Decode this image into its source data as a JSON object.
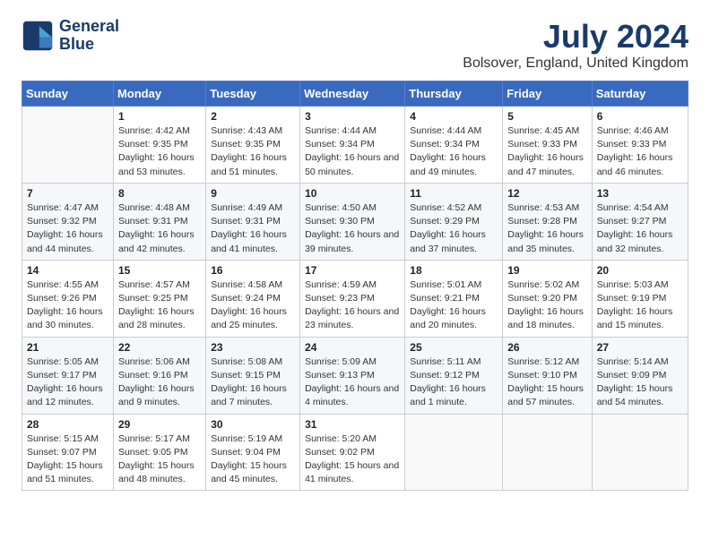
{
  "header": {
    "logo_line1": "General",
    "logo_line2": "Blue",
    "main_title": "July 2024",
    "subtitle": "Bolsover, England, United Kingdom"
  },
  "calendar": {
    "days_of_week": [
      "Sunday",
      "Monday",
      "Tuesday",
      "Wednesday",
      "Thursday",
      "Friday",
      "Saturday"
    ],
    "weeks": [
      [
        {
          "day": "",
          "empty": true
        },
        {
          "day": "1",
          "rise": "Sunrise: 4:42 AM",
          "set": "Sunset: 9:35 PM",
          "daylight": "Daylight: 16 hours and 53 minutes."
        },
        {
          "day": "2",
          "rise": "Sunrise: 4:43 AM",
          "set": "Sunset: 9:35 PM",
          "daylight": "Daylight: 16 hours and 51 minutes."
        },
        {
          "day": "3",
          "rise": "Sunrise: 4:44 AM",
          "set": "Sunset: 9:34 PM",
          "daylight": "Daylight: 16 hours and 50 minutes."
        },
        {
          "day": "4",
          "rise": "Sunrise: 4:44 AM",
          "set": "Sunset: 9:34 PM",
          "daylight": "Daylight: 16 hours and 49 minutes."
        },
        {
          "day": "5",
          "rise": "Sunrise: 4:45 AM",
          "set": "Sunset: 9:33 PM",
          "daylight": "Daylight: 16 hours and 47 minutes."
        },
        {
          "day": "6",
          "rise": "Sunrise: 4:46 AM",
          "set": "Sunset: 9:33 PM",
          "daylight": "Daylight: 16 hours and 46 minutes."
        }
      ],
      [
        {
          "day": "7",
          "rise": "Sunrise: 4:47 AM",
          "set": "Sunset: 9:32 PM",
          "daylight": "Daylight: 16 hours and 44 minutes."
        },
        {
          "day": "8",
          "rise": "Sunrise: 4:48 AM",
          "set": "Sunset: 9:31 PM",
          "daylight": "Daylight: 16 hours and 42 minutes."
        },
        {
          "day": "9",
          "rise": "Sunrise: 4:49 AM",
          "set": "Sunset: 9:31 PM",
          "daylight": "Daylight: 16 hours and 41 minutes."
        },
        {
          "day": "10",
          "rise": "Sunrise: 4:50 AM",
          "set": "Sunset: 9:30 PM",
          "daylight": "Daylight: 16 hours and 39 minutes."
        },
        {
          "day": "11",
          "rise": "Sunrise: 4:52 AM",
          "set": "Sunset: 9:29 PM",
          "daylight": "Daylight: 16 hours and 37 minutes."
        },
        {
          "day": "12",
          "rise": "Sunrise: 4:53 AM",
          "set": "Sunset: 9:28 PM",
          "daylight": "Daylight: 16 hours and 35 minutes."
        },
        {
          "day": "13",
          "rise": "Sunrise: 4:54 AM",
          "set": "Sunset: 9:27 PM",
          "daylight": "Daylight: 16 hours and 32 minutes."
        }
      ],
      [
        {
          "day": "14",
          "rise": "Sunrise: 4:55 AM",
          "set": "Sunset: 9:26 PM",
          "daylight": "Daylight: 16 hours and 30 minutes."
        },
        {
          "day": "15",
          "rise": "Sunrise: 4:57 AM",
          "set": "Sunset: 9:25 PM",
          "daylight": "Daylight: 16 hours and 28 minutes."
        },
        {
          "day": "16",
          "rise": "Sunrise: 4:58 AM",
          "set": "Sunset: 9:24 PM",
          "daylight": "Daylight: 16 hours and 25 minutes."
        },
        {
          "day": "17",
          "rise": "Sunrise: 4:59 AM",
          "set": "Sunset: 9:23 PM",
          "daylight": "Daylight: 16 hours and 23 minutes."
        },
        {
          "day": "18",
          "rise": "Sunrise: 5:01 AM",
          "set": "Sunset: 9:21 PM",
          "daylight": "Daylight: 16 hours and 20 minutes."
        },
        {
          "day": "19",
          "rise": "Sunrise: 5:02 AM",
          "set": "Sunset: 9:20 PM",
          "daylight": "Daylight: 16 hours and 18 minutes."
        },
        {
          "day": "20",
          "rise": "Sunrise: 5:03 AM",
          "set": "Sunset: 9:19 PM",
          "daylight": "Daylight: 16 hours and 15 minutes."
        }
      ],
      [
        {
          "day": "21",
          "rise": "Sunrise: 5:05 AM",
          "set": "Sunset: 9:17 PM",
          "daylight": "Daylight: 16 hours and 12 minutes."
        },
        {
          "day": "22",
          "rise": "Sunrise: 5:06 AM",
          "set": "Sunset: 9:16 PM",
          "daylight": "Daylight: 16 hours and 9 minutes."
        },
        {
          "day": "23",
          "rise": "Sunrise: 5:08 AM",
          "set": "Sunset: 9:15 PM",
          "daylight": "Daylight: 16 hours and 7 minutes."
        },
        {
          "day": "24",
          "rise": "Sunrise: 5:09 AM",
          "set": "Sunset: 9:13 PM",
          "daylight": "Daylight: 16 hours and 4 minutes."
        },
        {
          "day": "25",
          "rise": "Sunrise: 5:11 AM",
          "set": "Sunset: 9:12 PM",
          "daylight": "Daylight: 16 hours and 1 minute."
        },
        {
          "day": "26",
          "rise": "Sunrise: 5:12 AM",
          "set": "Sunset: 9:10 PM",
          "daylight": "Daylight: 15 hours and 57 minutes."
        },
        {
          "day": "27",
          "rise": "Sunrise: 5:14 AM",
          "set": "Sunset: 9:09 PM",
          "daylight": "Daylight: 15 hours and 54 minutes."
        }
      ],
      [
        {
          "day": "28",
          "rise": "Sunrise: 5:15 AM",
          "set": "Sunset: 9:07 PM",
          "daylight": "Daylight: 15 hours and 51 minutes."
        },
        {
          "day": "29",
          "rise": "Sunrise: 5:17 AM",
          "set": "Sunset: 9:05 PM",
          "daylight": "Daylight: 15 hours and 48 minutes."
        },
        {
          "day": "30",
          "rise": "Sunrise: 5:19 AM",
          "set": "Sunset: 9:04 PM",
          "daylight": "Daylight: 15 hours and 45 minutes."
        },
        {
          "day": "31",
          "rise": "Sunrise: 5:20 AM",
          "set": "Sunset: 9:02 PM",
          "daylight": "Daylight: 15 hours and 41 minutes."
        },
        {
          "day": "",
          "empty": true
        },
        {
          "day": "",
          "empty": true
        },
        {
          "day": "",
          "empty": true
        }
      ]
    ]
  }
}
